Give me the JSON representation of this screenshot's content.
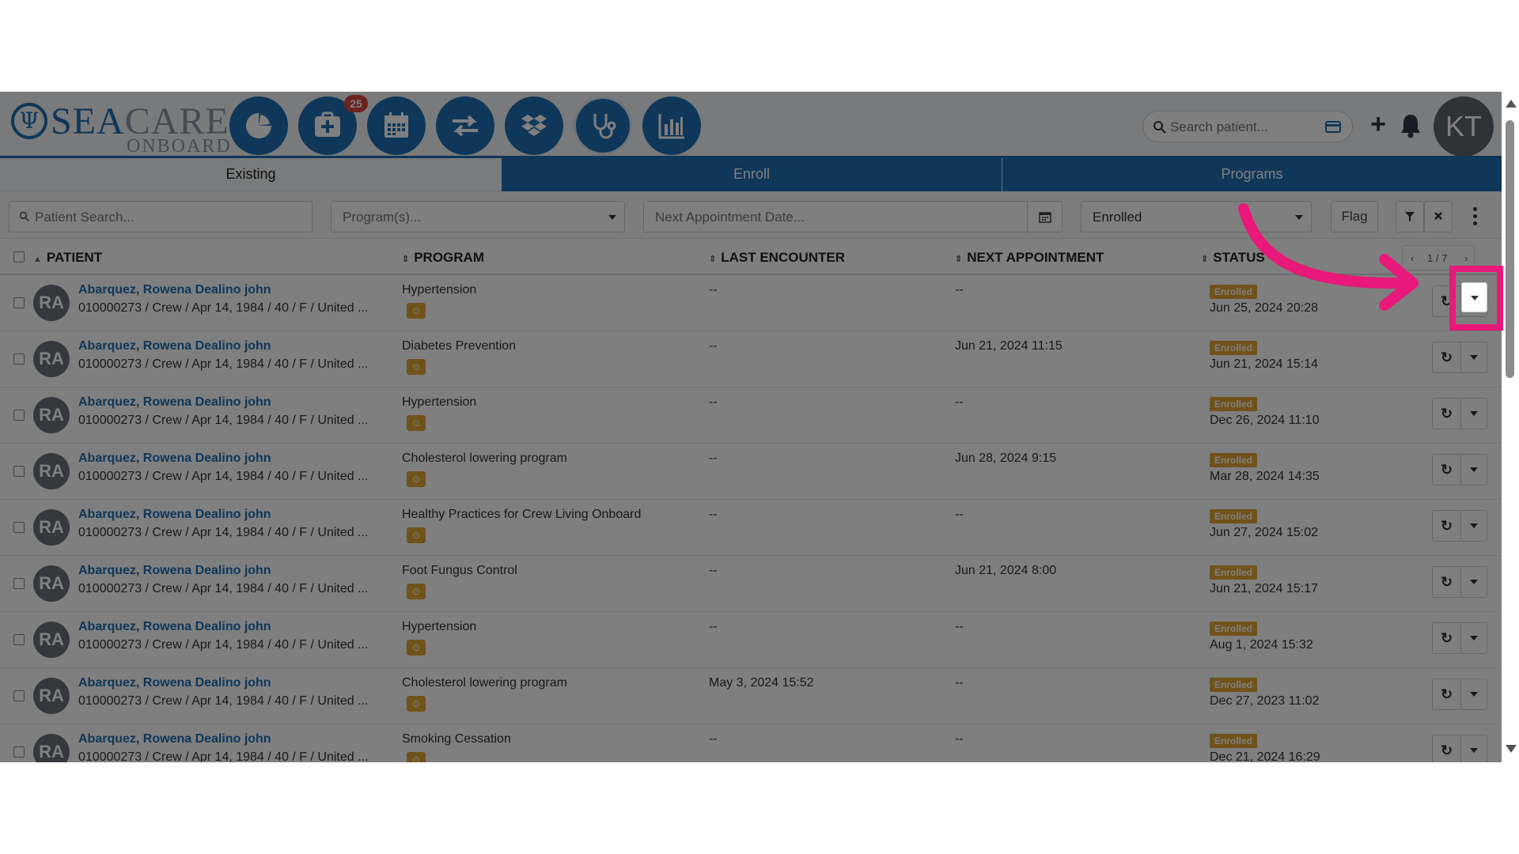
{
  "header": {
    "logo_sea": "SEA",
    "logo_care": "CARE",
    "logo_sub": "ONBOARD",
    "notification_count": "25",
    "search_placeholder": "Search patient...",
    "avatar_initials": "KT",
    "nav_icons": [
      "dashboard-pie-icon",
      "add-case-icon",
      "calendar-icon",
      "transfer-icon",
      "dropbox-icon",
      "stethoscope-icon",
      "bar-chart-icon"
    ]
  },
  "tabs": [
    "Existing",
    "Enroll",
    "Programs"
  ],
  "filters": {
    "patient_search_placeholder": "Patient Search...",
    "programs_placeholder": "Program(s)...",
    "next_appointment_placeholder": "Next Appointment Date...",
    "status_value": "Enrolled",
    "flag_label": "Flag"
  },
  "table": {
    "columns": [
      "PATIENT",
      "PROGRAM",
      "LAST ENCOUNTER",
      "NEXT APPOINTMENT",
      "STATUS"
    ],
    "pager": {
      "prev": "‹",
      "page": "1 / 7",
      "next": "›"
    },
    "rows": [
      {
        "initials": "RA",
        "name": "Abarquez, Rowena Dealino john",
        "info": "010000273 / Crew / Apr 14, 1984 / 40 / F / United ...",
        "program": "Hypertension",
        "last_encounter": "--",
        "next_appointment": "--",
        "status": "Enrolled",
        "status_date": "Jun 25, 2024 20:28"
      },
      {
        "initials": "RA",
        "name": "Abarquez, Rowena Dealino john",
        "info": "010000273 / Crew / Apr 14, 1984 / 40 / F / United ...",
        "program": "Diabetes Prevention",
        "last_encounter": "--",
        "next_appointment": "Jun 21, 2024 11:15",
        "status": "Enrolled",
        "status_date": "Jun 21, 2024 15:14"
      },
      {
        "initials": "RA",
        "name": "Abarquez, Rowena Dealino john",
        "info": "010000273 / Crew / Apr 14, 1984 / 40 / F / United ...",
        "program": "Hypertension",
        "last_encounter": "--",
        "next_appointment": "--",
        "status": "Enrolled",
        "status_date": "Dec 26, 2024 11:10"
      },
      {
        "initials": "RA",
        "name": "Abarquez, Rowena Dealino john",
        "info": "010000273 / Crew / Apr 14, 1984 / 40 / F / United ...",
        "program": "Cholesterol lowering program",
        "last_encounter": "--",
        "next_appointment": "Jun 28, 2024 9:15",
        "status": "Enrolled",
        "status_date": "Mar 28, 2024 14:35"
      },
      {
        "initials": "RA",
        "name": "Abarquez, Rowena Dealino john",
        "info": "010000273 / Crew / Apr 14, 1984 / 40 / F / United ...",
        "program": "Healthy Practices for Crew Living Onboard",
        "last_encounter": "--",
        "next_appointment": "--",
        "status": "Enrolled",
        "status_date": "Jun 27, 2024 15:02"
      },
      {
        "initials": "RA",
        "name": "Abarquez, Rowena Dealino john",
        "info": "010000273 / Crew / Apr 14, 1984 / 40 / F / United ...",
        "program": "Foot Fungus Control",
        "last_encounter": "--",
        "next_appointment": "Jun 21, 2024 8:00",
        "status": "Enrolled",
        "status_date": "Jun 21, 2024 15:17"
      },
      {
        "initials": "RA",
        "name": "Abarquez, Rowena Dealino john",
        "info": "010000273 / Crew / Apr 14, 1984 / 40 / F / United ...",
        "program": "Hypertension",
        "last_encounter": "--",
        "next_appointment": "--",
        "status": "Enrolled",
        "status_date": "Aug 1, 2024 15:32"
      },
      {
        "initials": "RA",
        "name": "Abarquez, Rowena Dealino john",
        "info": "010000273 / Crew / Apr 14, 1984 / 40 / F / United ...",
        "program": "Cholesterol lowering program",
        "last_encounter": "May 3, 2024 15:52",
        "next_appointment": "--",
        "status": "Enrolled",
        "status_date": "Dec 27, 2023 11:02"
      },
      {
        "initials": "RA",
        "name": "Abarquez, Rowena Dealino john",
        "info": "010000273 / Crew / Apr 14, 1984 / 40 / F / United ...",
        "program": "Smoking Cessation",
        "last_encounter": "--",
        "next_appointment": "--",
        "status": "Enrolled",
        "status_date": "Dec 21, 2024 16:29"
      }
    ]
  },
  "colors": {
    "primary": "#1f6fb3",
    "status_badge": "#e0a436",
    "highlight": "#e8197a",
    "badge_red": "#d9443c"
  }
}
